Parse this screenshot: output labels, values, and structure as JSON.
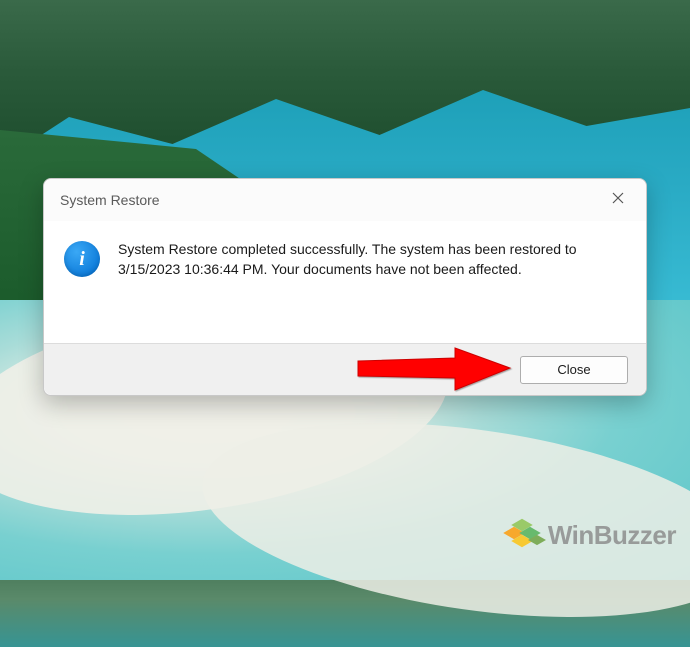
{
  "dialog": {
    "title": "System Restore",
    "message": "System Restore completed successfully. The system has been restored to 3/15/2023 10:36:44 PM. Your documents have not been affected.",
    "close_button_label": "Close",
    "info_glyph": "i"
  },
  "watermark": {
    "text": "WinBuzzer"
  }
}
